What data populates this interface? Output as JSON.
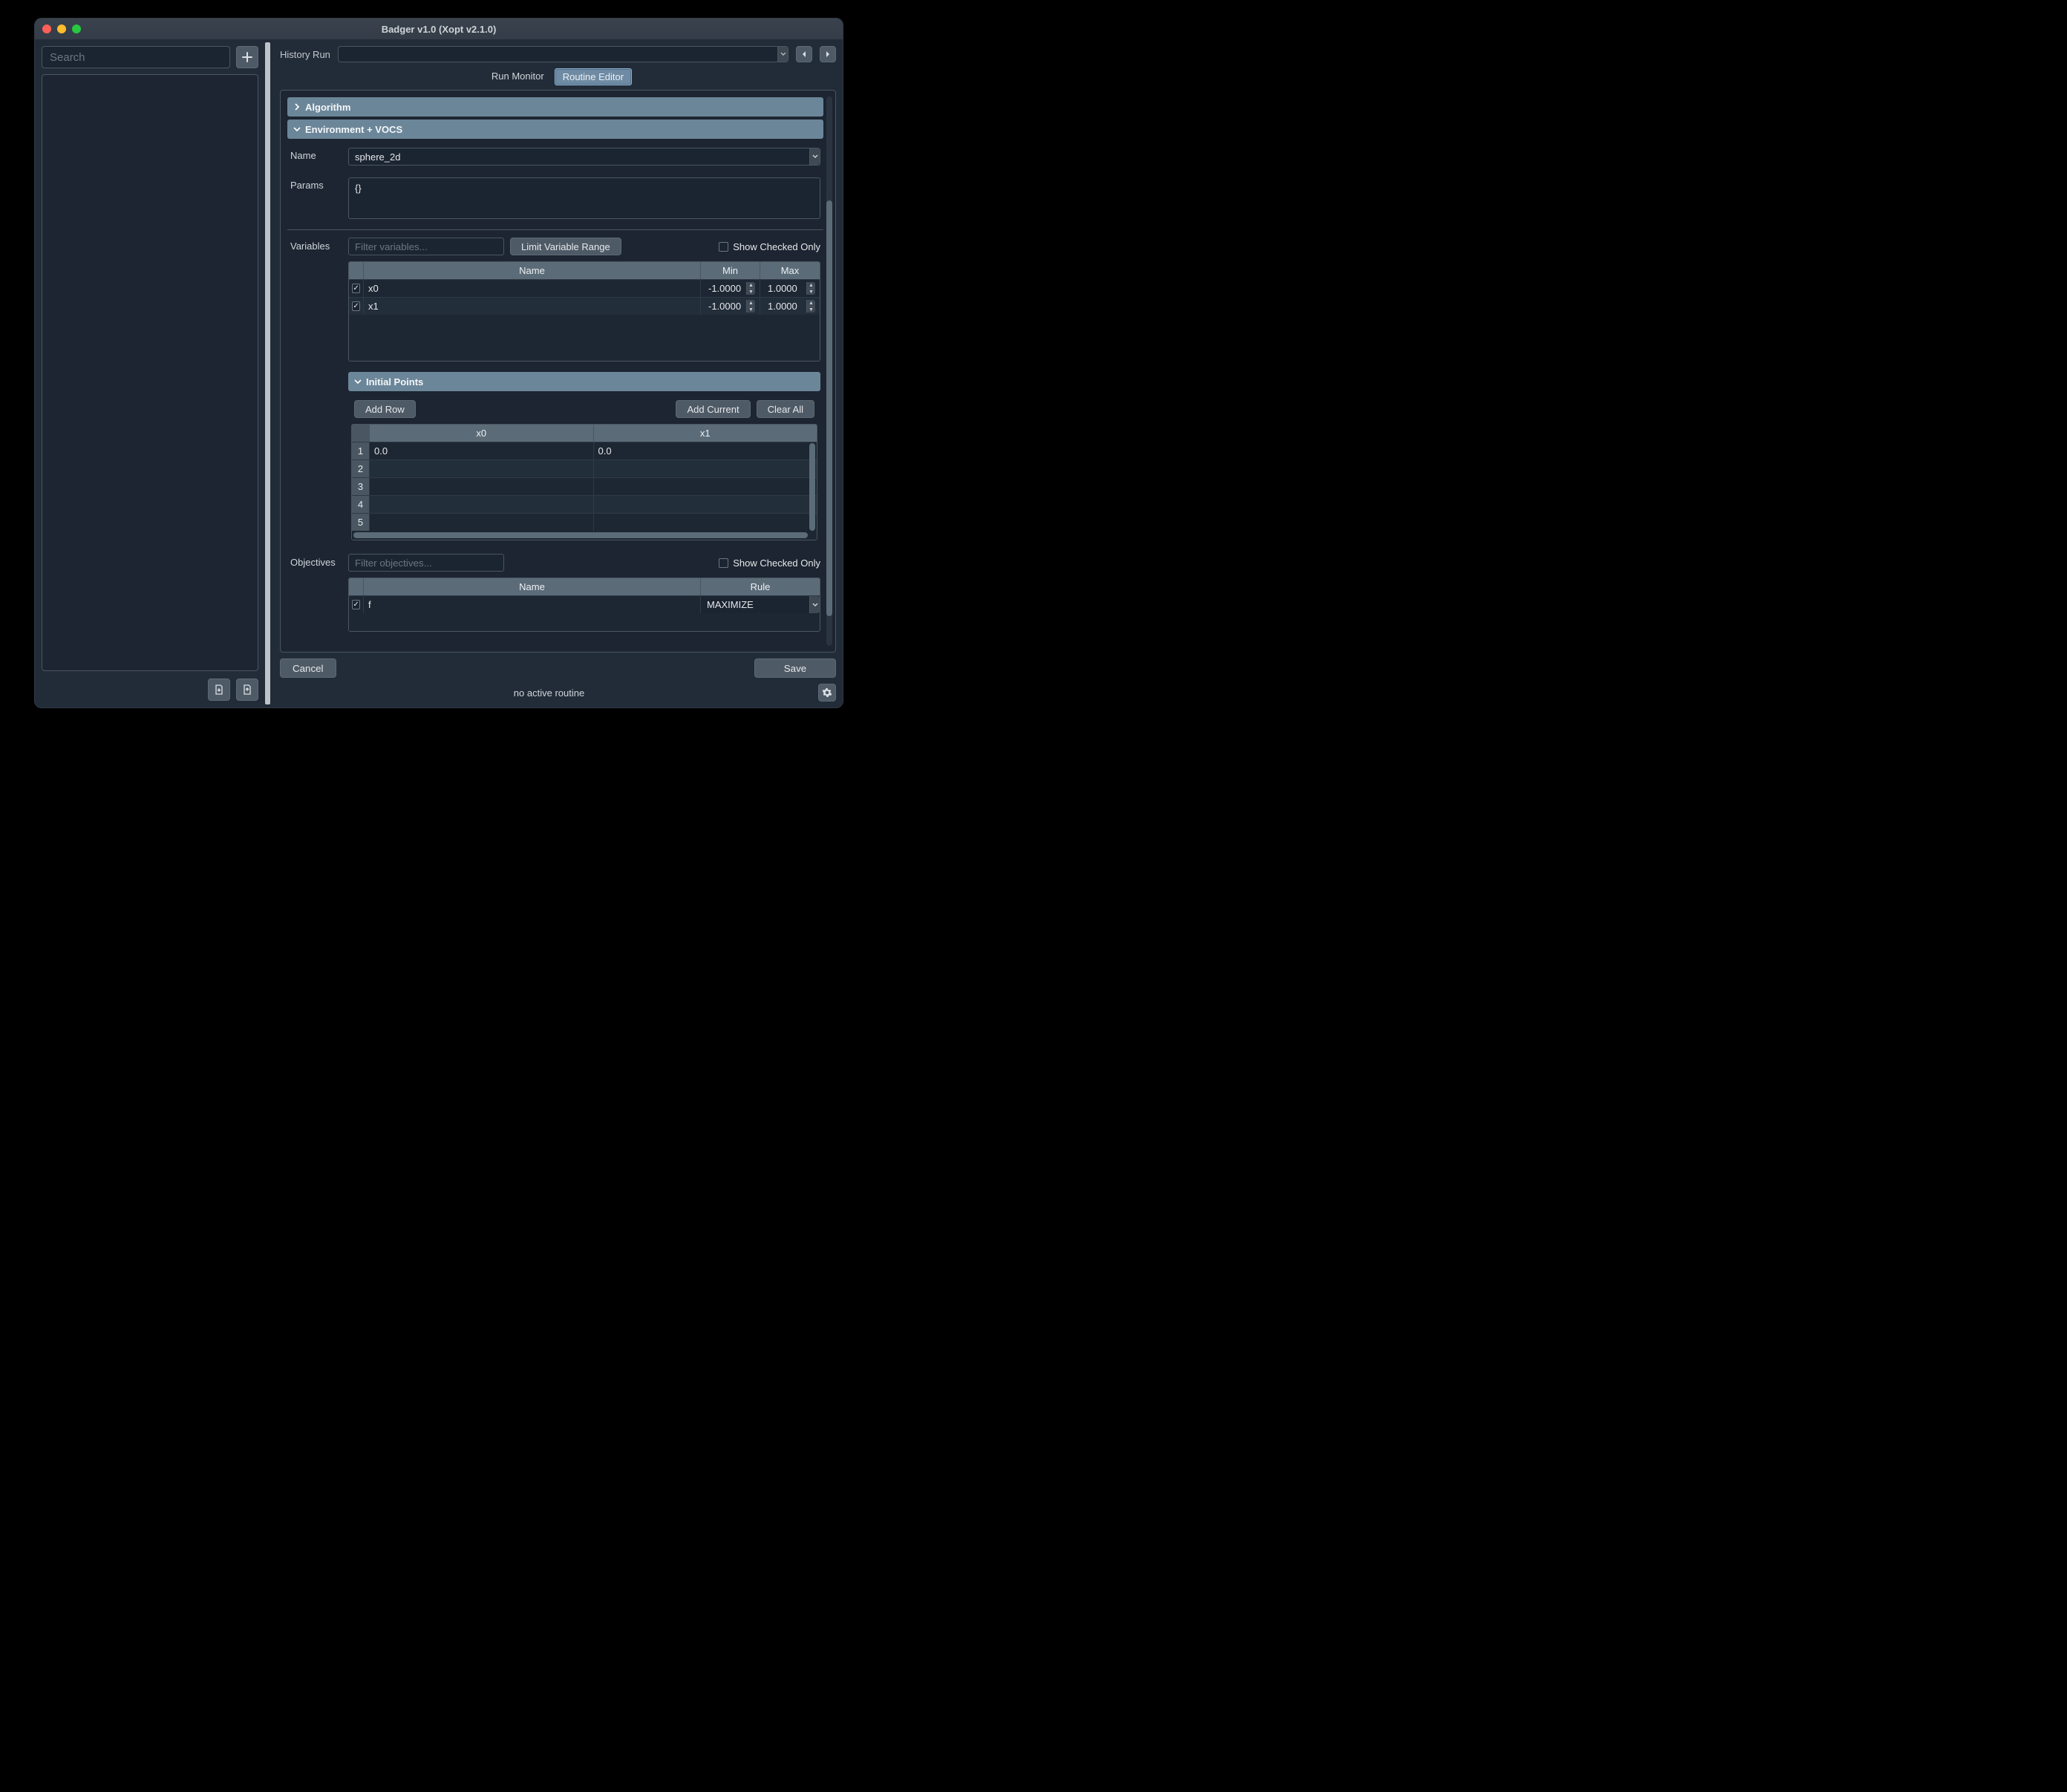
{
  "window": {
    "title": "Badger v1.0 (Xopt v2.1.0)"
  },
  "sidebar": {
    "search_placeholder": "Search"
  },
  "header": {
    "history_label": "History Run",
    "tabs": {
      "monitor": "Run Monitor",
      "editor": "Routine Editor"
    }
  },
  "sections": {
    "algorithm": "Algorithm",
    "env": "Environment + VOCS",
    "initial_points": "Initial Points"
  },
  "env": {
    "name_label": "Name",
    "name_value": "sphere_2d",
    "params_label": "Params",
    "params_value": "{}"
  },
  "variables": {
    "label": "Variables",
    "filter_placeholder": "Filter variables...",
    "limit_btn": "Limit Variable Range",
    "show_checked": "Show Checked Only",
    "headers": {
      "name": "Name",
      "min": "Min",
      "max": "Max"
    },
    "rows": [
      {
        "checked": true,
        "name": "x0",
        "min": "-1.0000",
        "max": "1.0000"
      },
      {
        "checked": true,
        "name": "x1",
        "min": "-1.0000",
        "max": "1.0000"
      }
    ]
  },
  "initial_points": {
    "add_row": "Add Row",
    "add_current": "Add Current",
    "clear_all": "Clear All",
    "headers": {
      "x0": "x0",
      "x1": "x1"
    },
    "rows": [
      {
        "idx": "1",
        "x0": "0.0",
        "x1": "0.0"
      },
      {
        "idx": "2",
        "x0": "",
        "x1": ""
      },
      {
        "idx": "3",
        "x0": "",
        "x1": ""
      },
      {
        "idx": "4",
        "x0": "",
        "x1": ""
      },
      {
        "idx": "5",
        "x0": "",
        "x1": ""
      }
    ]
  },
  "objectives": {
    "label": "Objectives",
    "filter_placeholder": "Filter objectives...",
    "show_checked": "Show Checked Only",
    "headers": {
      "name": "Name",
      "rule": "Rule"
    },
    "rows": [
      {
        "checked": true,
        "name": "f",
        "rule": "MAXIMIZE"
      }
    ]
  },
  "actions": {
    "cancel": "Cancel",
    "save": "Save"
  },
  "footer": {
    "status": "no active routine"
  }
}
